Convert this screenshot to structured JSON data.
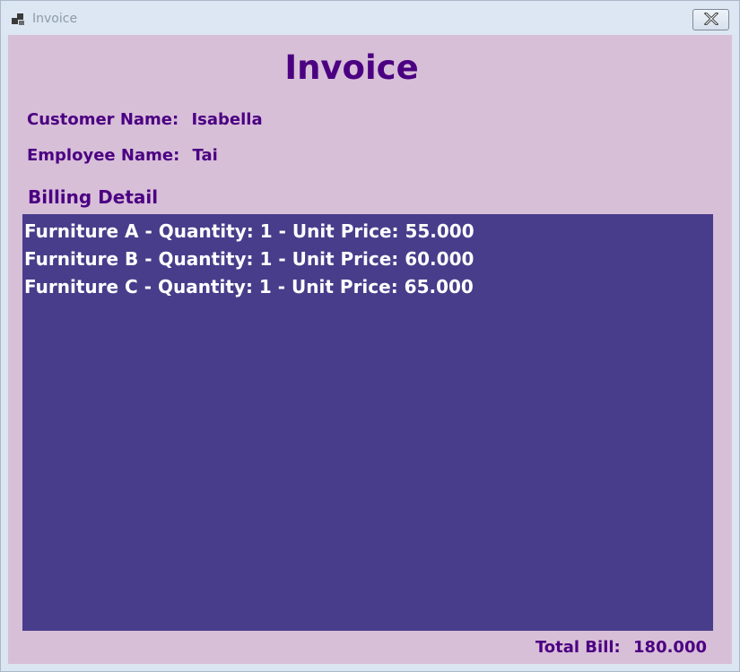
{
  "window": {
    "title": "Invoice",
    "icons": {
      "app": "app-icon",
      "close": "close-icon"
    }
  },
  "form": {
    "heading": "Invoice",
    "customer": {
      "label": "Customer Name:",
      "value": "Isabella"
    },
    "employee": {
      "label": "Employee Name:",
      "value": "Tai"
    },
    "billing_title": "Billing Detail",
    "billing_items": [
      "Furniture A - Quantity: 1 - Unit Price: 55.000",
      "Furniture B - Quantity: 1 - Unit Price: 60.000",
      "Furniture C - Quantity: 1 - Unit Price: 65.000"
    ],
    "total": {
      "label": "Total Bill:",
      "value": "180.000"
    }
  },
  "colors": {
    "form_background": "#d8bfd8",
    "text_accent": "#4b0082",
    "list_background": "#483d8b",
    "list_text": "#ffffff"
  }
}
